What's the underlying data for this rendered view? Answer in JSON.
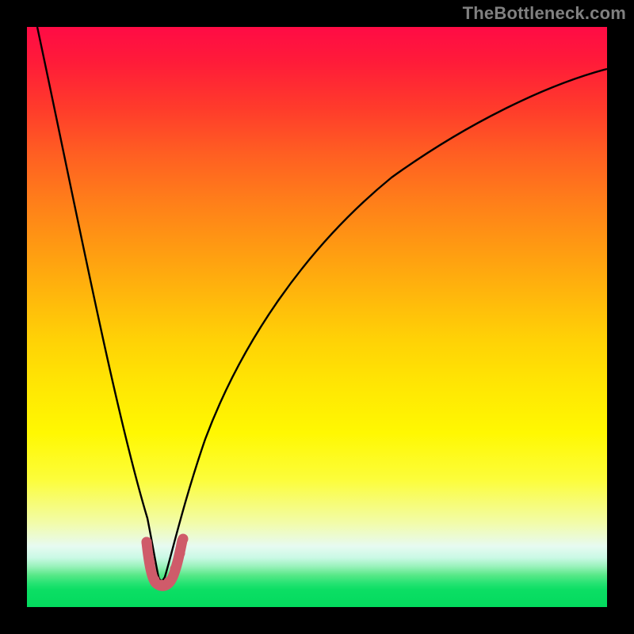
{
  "watermark": "TheBottleneck.com",
  "chart_data": {
    "type": "line",
    "title": "",
    "xlabel": "",
    "ylabel": "",
    "xlim": [
      0,
      100
    ],
    "ylim": [
      0,
      100
    ],
    "grid": false,
    "series": [
      {
        "name": "bottleneck-curve",
        "x": [
          0,
          2,
          4,
          6,
          8,
          10,
          12,
          14,
          16,
          18,
          19,
          20,
          21,
          21.5,
          22,
          22.5,
          23,
          23.5,
          24,
          25,
          27,
          30,
          34,
          40,
          48,
          58,
          70,
          84,
          100
        ],
        "values": [
          100,
          91,
          82,
          73,
          64,
          55,
          47,
          38,
          29,
          20,
          15,
          11,
          6,
          4,
          3,
          3,
          4,
          6,
          10,
          17,
          26,
          36,
          46,
          56,
          65,
          73,
          80,
          86,
          91
        ]
      },
      {
        "name": "highlight-marker",
        "x": [
          20.2,
          20.8,
          21.4,
          22.0,
          22.6,
          23.2,
          23.8,
          24.4
        ],
        "values": [
          9,
          5,
          3,
          3,
          3,
          4,
          7,
          11
        ]
      }
    ],
    "colors": {
      "curve": "#000000",
      "highlight": "#cf5b6a",
      "gradient_top": "#ff0b45",
      "gradient_bottom": "#03db5e"
    }
  }
}
